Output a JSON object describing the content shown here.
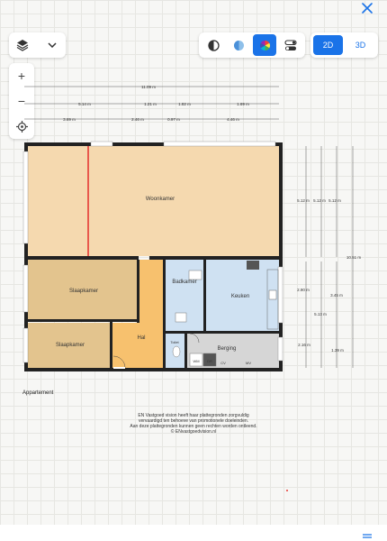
{
  "close_icon": "close-icon",
  "toolbar": {
    "layers_icon": "layers-icon",
    "view_modes": [
      "contrast-icon",
      "half-circle-icon",
      "color-wheel-icon",
      "toggle-icon"
    ],
    "dim_2d": "2D",
    "dim_3d": "3D"
  },
  "zoom": {
    "zoom_in": "+",
    "zoom_out": "−"
  },
  "dimensions": {
    "total_width": "11.09 m",
    "row2": [
      "5.14 m",
      "1.21 m",
      "1.82 m",
      "1.69 m"
    ],
    "row3": [
      "3.69 m",
      "2.46 m",
      "0.97 m",
      "4.46 m"
    ],
    "right_cols": [
      "5.12 m",
      "5.12 m",
      "5.12 m",
      "10.51 m"
    ],
    "right_lower": [
      "2.90 m",
      "3.45 m",
      "5.13 m",
      "2.16 m",
      "1.39 m"
    ]
  },
  "rooms": {
    "woonkamer": "Woonkamer",
    "slaapkamer1": "Slaapkamer",
    "slaapkamer2": "Slaapkamer",
    "badkamer": "Badkamer",
    "keuken": "Keuken",
    "hal": "Hal",
    "toilet": "Toilet",
    "berging": "Berging",
    "wm": "WM",
    "dr": "DR",
    "cv": "CV",
    "mv": "MV"
  },
  "floor_label": "Appartement",
  "disclaimer": [
    "EN Vastgoed vision heeft haar plattegronden zorgvuldig",
    "vervaardigd ten behoeve van promotionele doeleinden.",
    "Aan deze plattegronden kunnen geen rechten worden ontleend.",
    "© ENvastgoedvision.nl"
  ],
  "colors": {
    "active_blue": "#1a73e8",
    "woonkamer_fill": "#f5d9af",
    "slaapkamer_fill": "#e3c48e",
    "hal_fill": "#f7c16e",
    "wet_fill": "#cfe1f2",
    "berging_fill": "#d6d6d6"
  }
}
